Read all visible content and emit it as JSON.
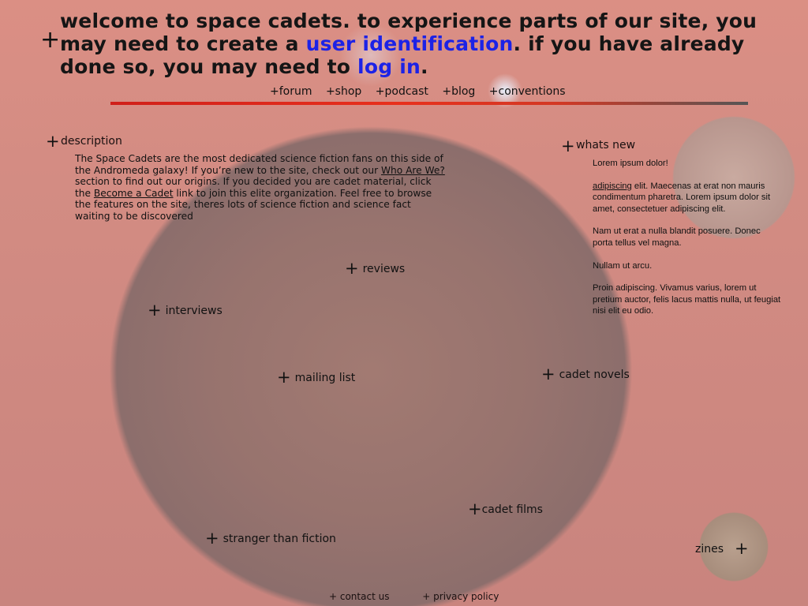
{
  "header": {
    "plus_icon": "+",
    "text_1": "welcome to space cadets.  to experience parts of our site, you may need to create a ",
    "link_user_id": "user identification",
    "text_2": ". if you have already done so, you may need to ",
    "link_login": "log in",
    "text_3": "."
  },
  "top_nav": [
    "+forum",
    "+shop",
    "+podcast",
    "+blog",
    "+conventions"
  ],
  "description": {
    "heading": "description",
    "text_1": "The Space Cadets are the most dedicated science fiction fans on this side of the Andromeda galaxy!  If you’re new to the site, check out our ",
    "link_who": "Who Are We?",
    "text_2": " section to find out our origins.  If you decided you are cadet material, click the ",
    "link_become": "Become a Cadet",
    "text_3": " link to join this elite organization.  Feel free to browse the features on the site, theres lots of science fiction and science fact waiting to be discovered"
  },
  "whats_new": {
    "heading": "whats new",
    "p1": "Lorem ipsum dolor!",
    "p2_link": "adipiscing",
    "p2_text": " elit. Maecenas at erat non mauris condimentum pharetra. Lorem ipsum dolor sit amet, consectetuer adipiscing elit.",
    "p3": "Nam ut erat a nulla blandit posuere. Donec porta tellus vel magna.",
    "p4": "Nullam ut arcu.",
    "p5": "Proin adipiscing. Vivamus varius, lorem ut pretium auctor, felis lacus mattis nulla, ut feugiat nisi elit eu odio."
  },
  "links": {
    "reviews": "reviews",
    "interviews": "interviews",
    "mailing_list": "mailing list",
    "cadet_novels": "cadet novels",
    "cadet_films": "cadet films",
    "stranger_than_fiction": "stranger than fiction",
    "zines": "zines",
    "plus": "+"
  },
  "footer": {
    "contact": "+ contact us",
    "privacy": "+ privacy policy"
  }
}
